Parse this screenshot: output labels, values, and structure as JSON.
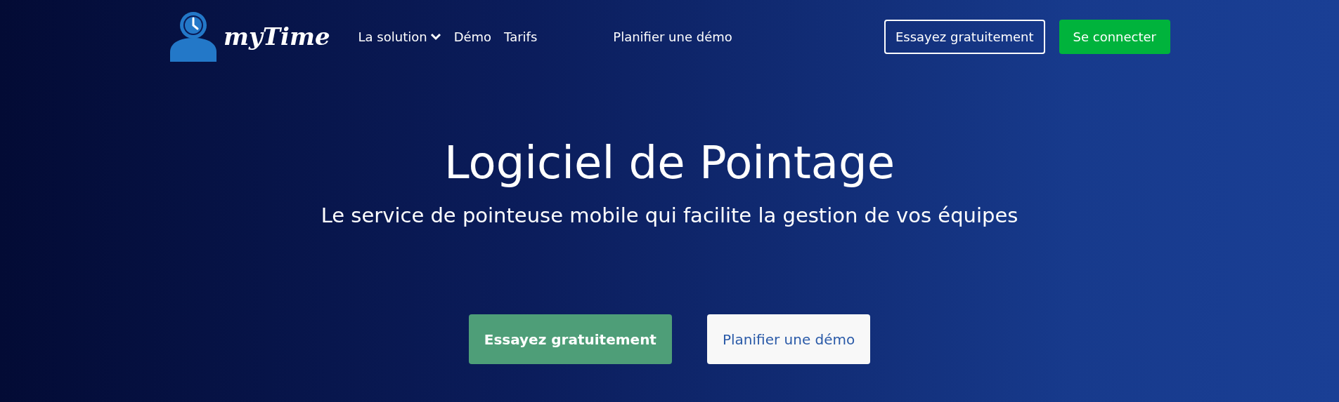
{
  "header": {
    "logo": "myTime",
    "nav": [
      {
        "label": "La solution",
        "kind": "dropdown"
      },
      {
        "label": "Démo",
        "kind": "link"
      },
      {
        "label": "Tarifs",
        "kind": "link"
      },
      {
        "label": "Planifier une démo",
        "kind": "spaced"
      }
    ],
    "buttons": [
      {
        "label": "Essayez gratuitement",
        "kind": "outline"
      },
      {
        "label": "Se connecter",
        "kind": "green"
      }
    ]
  },
  "hero": {
    "title": "Logiciel de Pointage",
    "subtitle": "Le service de pointeuse mobile qui facilite la gestion de vos équipes",
    "buttons": [
      {
        "label": "Essayez gratuitement",
        "kind": "soft-green"
      },
      {
        "label": "Planifier une démo",
        "kind": "light"
      }
    ]
  }
}
